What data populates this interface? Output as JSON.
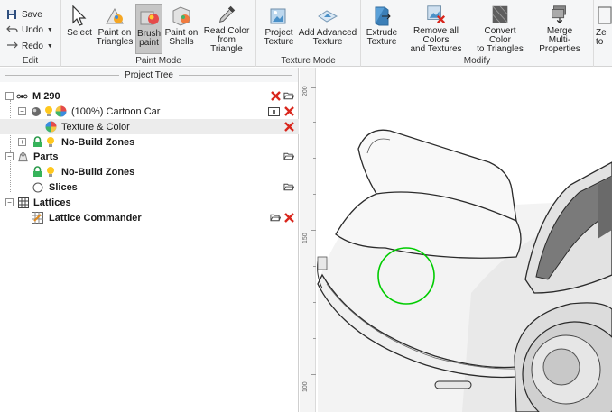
{
  "ribbon": {
    "edit": {
      "label": "Edit",
      "save": "Save",
      "undo": "Undo",
      "redo": "Redo"
    },
    "paint_mode": {
      "label": "Paint Mode",
      "select": "Select",
      "paint_triangles": [
        "Paint on",
        "Triangles"
      ],
      "brush_paint": [
        "Brush",
        "paint"
      ],
      "paint_shells": [
        "Paint on",
        "Shells"
      ],
      "read_color": [
        "Read Color",
        "from Triangle"
      ]
    },
    "texture_mode": {
      "label": "Texture Mode",
      "project_texture": [
        "Project",
        "Texture"
      ],
      "add_advanced": [
        "Add Advanced",
        "Texture"
      ]
    },
    "modify": {
      "label": "Modify",
      "extrude": [
        "Extrude",
        "Texture"
      ],
      "remove_all": [
        "Remove all Colors",
        "and Textures"
      ],
      "convert_color": [
        "Convert Color",
        "to Triangles"
      ],
      "merge": [
        "Merge",
        "Multi-Properties"
      ]
    },
    "overflow": [
      "Ze",
      "to"
    ]
  },
  "project_tree": {
    "header": "Project Tree",
    "rows": [
      {
        "label": "M 290"
      },
      {
        "label": "(100%) Cartoon Car"
      },
      {
        "label": "Texture & Color"
      },
      {
        "label": "No-Build Zones"
      },
      {
        "label": "Parts"
      },
      {
        "label": "No-Build Zones"
      },
      {
        "label": "Slices"
      },
      {
        "label": "Lattices"
      },
      {
        "label": "Lattice Commander"
      }
    ]
  },
  "viewport": {
    "ruler_labels": [
      "200",
      "150",
      "100"
    ]
  },
  "colors": {
    "accent_red": "#d9261c",
    "selection_circle": "#00cc00",
    "active_button": "#c6c6c6"
  }
}
